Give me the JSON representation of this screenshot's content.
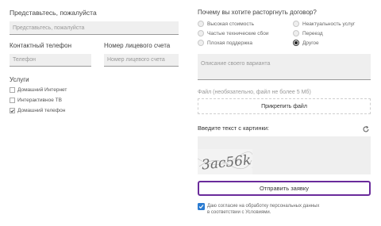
{
  "contact": {
    "name_label": "Представьтесь, пожалуйста",
    "name_placeholder": "Представьтесь, пожалуйста",
    "phone_label": "Контактный телефон",
    "phone_placeholder": "Телефон",
    "account_label": "Номер лицевого счета",
    "account_placeholder": "Номер лицевого счета"
  },
  "services": {
    "label": "Услуги",
    "items": [
      {
        "label": "Домашний Интернет",
        "checked": false
      },
      {
        "label": "Интерактивное ТВ",
        "checked": false
      },
      {
        "label": "Домашний телефон",
        "checked": true
      }
    ]
  },
  "reason": {
    "label": "Почему вы хотите расторгнуть договор?",
    "options": [
      {
        "label": "Высокая стоимость",
        "selected": false
      },
      {
        "label": "Неактуальность услуг",
        "selected": false
      },
      {
        "label": "Частые технические сбои",
        "selected": false
      },
      {
        "label": "Переезд",
        "selected": false
      },
      {
        "label": "Плохая поддержка",
        "selected": false
      },
      {
        "label": "Другое",
        "selected": true
      }
    ],
    "other_placeholder": "Описание своего варианта"
  },
  "file": {
    "label": "Файл (необязательно, файл не более 5 Мб)",
    "attach_button": "Прикрепить файл"
  },
  "captcha": {
    "label": "Введите текст с картинки:",
    "refresh_icon": "refresh-icon",
    "image_text": "3ac56k"
  },
  "submit_label": "Отправить заявку",
  "consent": {
    "checked": true,
    "line1": "Даю согласие на обработку персональных данных",
    "line2": "в соответствии с Условиями."
  },
  "colors": {
    "accent": "#6a2b9b",
    "consent_checkbox": "#2a7bd1",
    "field_bg": "#efefef"
  }
}
